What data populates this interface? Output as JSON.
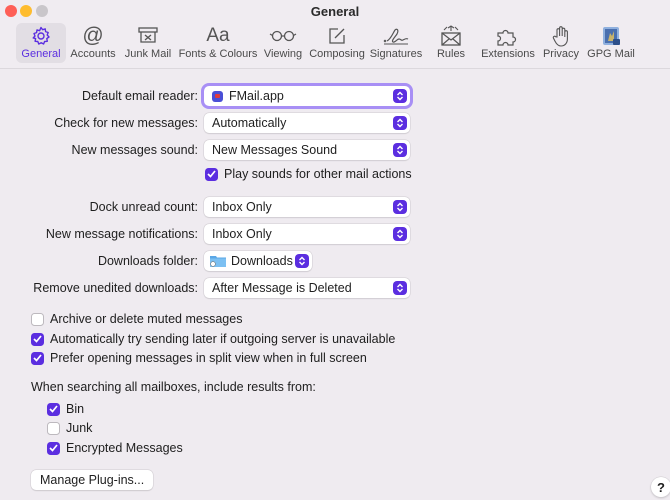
{
  "window": {
    "title": "General"
  },
  "toolbar": {
    "items": [
      {
        "label": "General",
        "icon": "gear-icon",
        "active": true
      },
      {
        "label": "Accounts",
        "icon": "at-icon"
      },
      {
        "label": "Junk Mail",
        "icon": "junk-tray-icon"
      },
      {
        "label": "Fonts & Colours",
        "icon": "font-aa-icon"
      },
      {
        "label": "Viewing",
        "icon": "glasses-icon"
      },
      {
        "label": "Composing",
        "icon": "compose-icon"
      },
      {
        "label": "Signatures",
        "icon": "signature-icon"
      },
      {
        "label": "Rules",
        "icon": "rules-envelope-icon"
      },
      {
        "label": "Extensions",
        "icon": "puzzle-icon"
      },
      {
        "label": "Privacy",
        "icon": "hand-icon"
      },
      {
        "label": "GPG Mail",
        "icon": "gpg-mail-icon"
      }
    ]
  },
  "settings": {
    "default_reader": {
      "label": "Default email reader:",
      "value": "FMail.app"
    },
    "check_messages": {
      "label": "Check for new messages:",
      "value": "Automatically"
    },
    "sound": {
      "label": "New messages sound:",
      "value": "New Messages Sound"
    },
    "play_sounds": {
      "label": "Play sounds for other mail actions",
      "checked": true
    },
    "dock_count": {
      "label": "Dock unread count:",
      "value": "Inbox Only"
    },
    "notifications": {
      "label": "New message notifications:",
      "value": "Inbox Only"
    },
    "downloads_folder": {
      "label": "Downloads folder:",
      "value": "Downloads"
    },
    "remove_downloads": {
      "label": "Remove unedited downloads:",
      "value": "After Message is Deleted"
    }
  },
  "options": [
    {
      "label": "Archive or delete muted messages",
      "checked": false
    },
    {
      "label": "Automatically try sending later if outgoing server is unavailable",
      "checked": true
    },
    {
      "label": "Prefer opening messages in split view when in full screen",
      "checked": true
    }
  ],
  "search": {
    "label": "When searching all mailboxes, include results from:",
    "items": [
      {
        "label": "Bin",
        "checked": true
      },
      {
        "label": "Junk",
        "checked": false
      },
      {
        "label": "Encrypted Messages",
        "checked": true
      }
    ]
  },
  "buttons": {
    "manage_plugins": "Manage Plug-ins...",
    "help": "?"
  },
  "colors": {
    "accent": "#5b2ee0",
    "focus_ring": "#a88ff5",
    "background": "#efebf0"
  }
}
